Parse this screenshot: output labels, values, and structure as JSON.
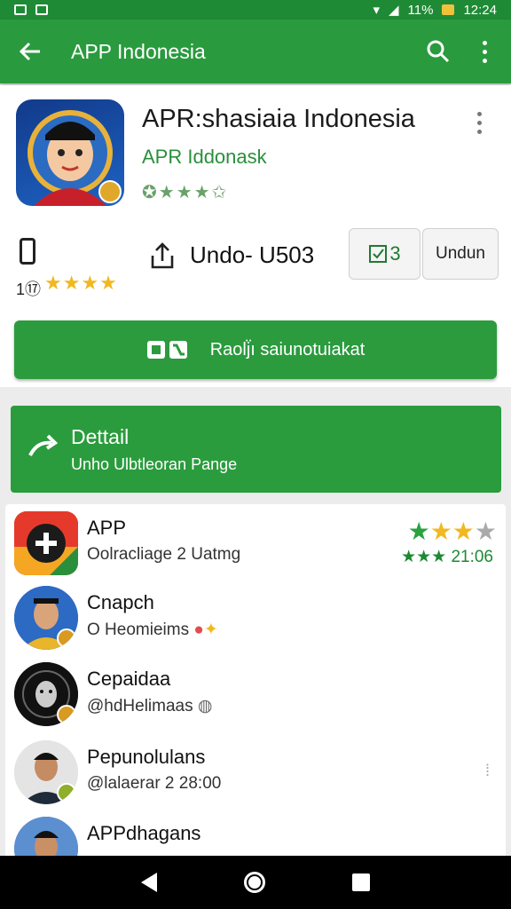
{
  "status_bar": {
    "battery": "11%",
    "time": "12:24"
  },
  "toolbar": {
    "title": "APP Indonesia",
    "back_icon": "arrow-left-icon",
    "search_icon": "search-icon",
    "menu_icon": "more-vert-icon"
  },
  "app": {
    "name": "APR:shasiaia Indonesia",
    "developer": "APR Iddonask",
    "rating_stars": "✪★★★✩",
    "stat_value": "1⑰",
    "stat_stars": "★★★★",
    "undo_label": "Undo- U503",
    "install_button": "3",
    "undun_button": "Undun",
    "green_button": "Raolj̈ı saiunotuiakat"
  },
  "detail": {
    "title": "Dettail",
    "subtitle": "Unho Ulbtleoran Pange"
  },
  "list": [
    {
      "name": "APP",
      "sub": "Oolracliage 2 Uatmg",
      "stars_top": "★★★★",
      "stars_bottom": "★★★ 21:06"
    },
    {
      "name": "Cnapch",
      "sub": "O Heomieims"
    },
    {
      "name": "Cepaidaa",
      "sub": "@hdHelimaas"
    },
    {
      "name": "Pepunolulans",
      "sub": "@lalaerar 2 28:00"
    },
    {
      "name": "APPdhagans",
      "sub": ""
    }
  ],
  "colors": {
    "primary": "#2a9a3e",
    "status": "#1f8a35",
    "developer": "#2a8f3c",
    "stars": "#f1b81f"
  }
}
